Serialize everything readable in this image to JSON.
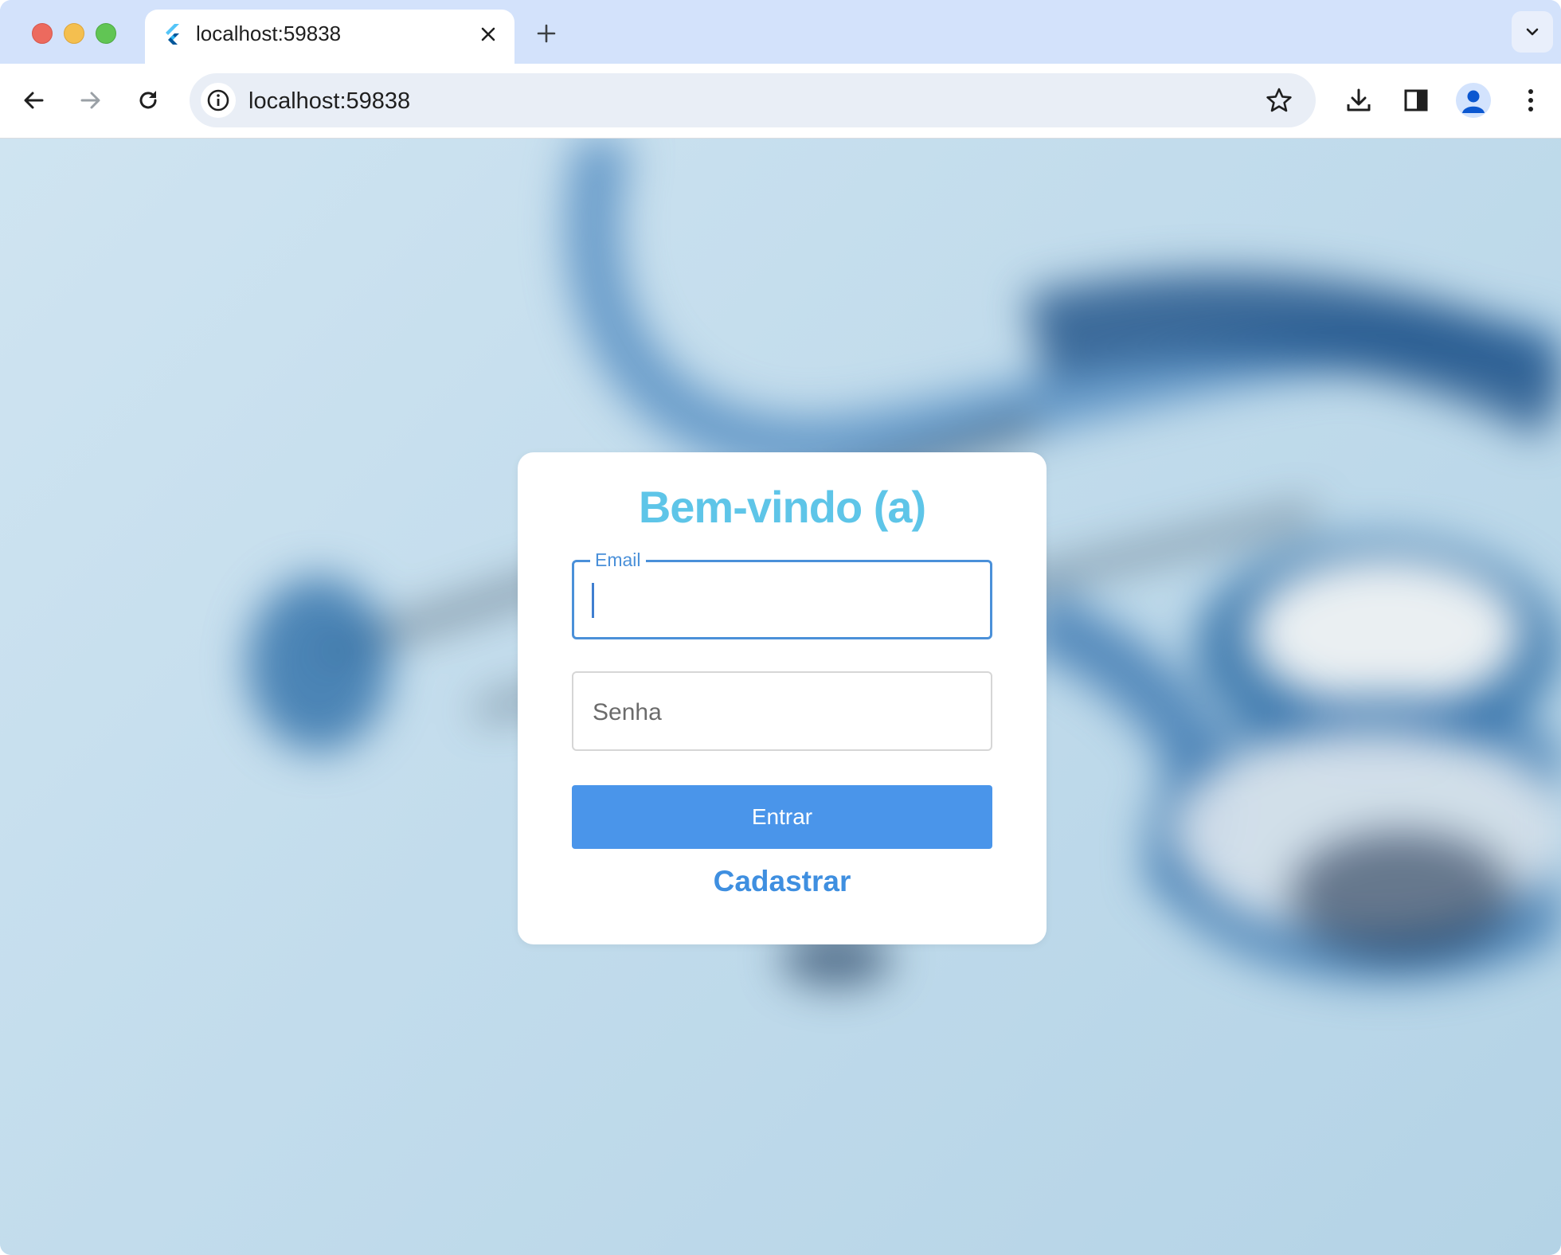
{
  "browser": {
    "tab": {
      "title": "localhost:59838",
      "favicon": "flutter-icon"
    },
    "address_bar": {
      "url": "localhost:59838"
    },
    "icons": [
      "back-arrow-icon",
      "forward-arrow-icon",
      "reload-icon",
      "site-info-icon",
      "bookmark-star-icon",
      "download-icon",
      "side-panel-icon",
      "profile-avatar-icon",
      "more-menu-icon",
      "tab-search-icon",
      "new-tab-icon",
      "close-tab-icon"
    ]
  },
  "login": {
    "title": "Bem-vindo (a)",
    "email_label": "Email",
    "email_value": "",
    "password_placeholder": "Senha",
    "submit_label": "Entrar",
    "register_label": "Cadastrar"
  },
  "colors": {
    "title": "#5ec5e8",
    "accent": "#4a90d9",
    "button": "#4a95ea",
    "link": "#3f8fe0",
    "tab_strip": "#d3e2fb"
  }
}
